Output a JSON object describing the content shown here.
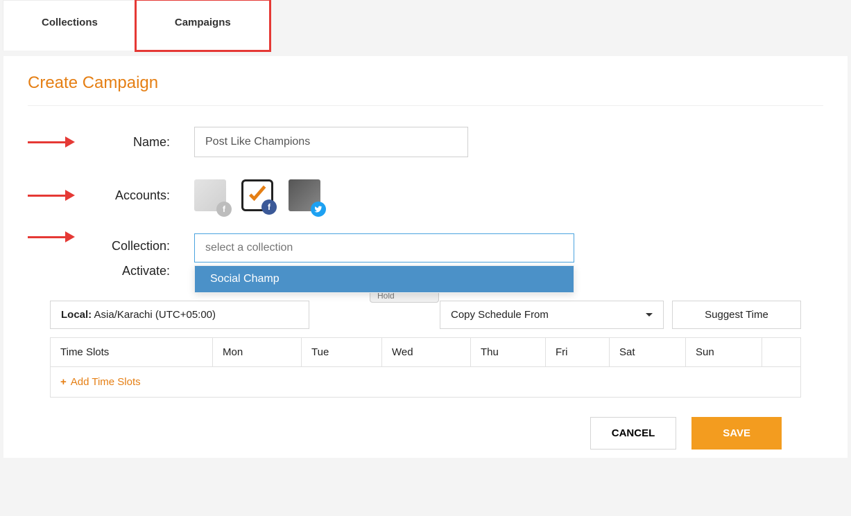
{
  "tabs": {
    "collections": "Collections",
    "campaigns": "Campaigns"
  },
  "title": "Create Campaign",
  "labels": {
    "name": "Name:",
    "accounts": "Accounts:",
    "collection": "Collection:",
    "activate": "Activate:"
  },
  "form": {
    "name_value": "Post Like Champions",
    "collection_placeholder": "select a collection",
    "collection_option": "Social Champ",
    "activate_hidden": "Hold"
  },
  "accounts": {
    "badge_fb_gray": "f",
    "badge_fb": "f",
    "badge_tw": ""
  },
  "schedule": {
    "local_label": "Local:",
    "local_value": " Asia/Karachi (UTC+05:00)",
    "copy_from": "Copy Schedule From",
    "suggest": "Suggest Time",
    "columns": [
      "Time Slots",
      "Mon",
      "Tue",
      "Wed",
      "Thu",
      "Fri",
      "Sat",
      "Sun"
    ],
    "add_slots": "Add Time Slots"
  },
  "actions": {
    "cancel": "CANCEL",
    "save": "SAVE"
  },
  "colors": {
    "accent": "#e57f14",
    "highlight_red": "#e53935",
    "dropdown_bg": "#4b91c8",
    "save_bg": "#f39c1f"
  }
}
